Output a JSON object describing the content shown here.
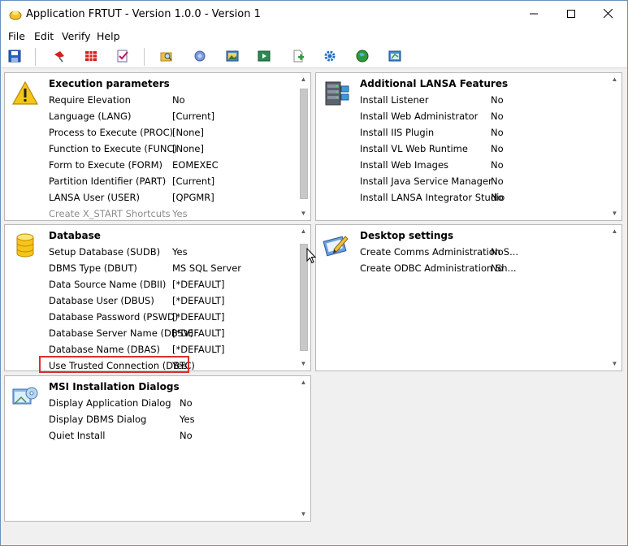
{
  "window": {
    "title": "Application FRTUT - Version 1.0.0 - Version 1"
  },
  "menu": [
    "File",
    "Edit",
    "Verify",
    "Help"
  ],
  "toolbar": [
    "save-icon",
    "pin-icon",
    "grid-icon",
    "verify-icon",
    "folder-search-icon",
    "component-icon",
    "image-icon",
    "media-icon",
    "add-file-icon",
    "gear-icon",
    "globe-icon",
    "window-icon"
  ],
  "colors": {
    "accent": "#1f5fbf",
    "highlight": "#d9302c",
    "panel_border": "#b8b8b8"
  },
  "execution": {
    "title": "Execution parameters",
    "icon": "warning-icon",
    "rows": [
      {
        "label": "Require Elevation",
        "value": "No"
      },
      {
        "label": "Language (LANG)",
        "value": "[Current]"
      },
      {
        "label": "Process to Execute (PROC)",
        "value": "[None]"
      },
      {
        "label": "Function to Execute (FUNC)",
        "value": "[None]"
      },
      {
        "label": "Form to Execute (FORM)",
        "value": "EOMEXEC"
      },
      {
        "label": "Partition Identifier (PART)",
        "value": "[Current]"
      },
      {
        "label": "LANSA User (USER)",
        "value": "[QPGMR]"
      },
      {
        "label": "Create X_START Shortcuts",
        "value": "Yes"
      }
    ]
  },
  "lansa": {
    "title": "Additional LANSA Features",
    "icon": "server-icon",
    "rows": [
      {
        "label": "Install Listener",
        "value": "No"
      },
      {
        "label": "Install Web Administrator",
        "value": "No"
      },
      {
        "label": "Install IIS Plugin",
        "value": "No"
      },
      {
        "label": "Install VL Web Runtime",
        "value": "No"
      },
      {
        "label": "Install Web Images",
        "value": "No"
      },
      {
        "label": "Install Java Service Manager",
        "value": "No"
      },
      {
        "label": "Install LANSA Integrator Studio",
        "value": "No"
      }
    ]
  },
  "database": {
    "title": "Database",
    "icon": "database-icon",
    "rows": [
      {
        "label": "Setup Database (SUDB)",
        "value": "Yes"
      },
      {
        "label": "DBMS Type (DBUT)",
        "value": "MS SQL Server"
      },
      {
        "label": "Data Source Name (DBII)",
        "value": "[*DEFAULT]"
      },
      {
        "label": "Database User (DBUS)",
        "value": "[*DEFAULT]"
      },
      {
        "label": "Database Password (PSWD)",
        "value": "[*DEFAULT]"
      },
      {
        "label": "Database Server Name (DBSV)",
        "value": "[*DEFAULT]"
      },
      {
        "label": "Database Name (DBAS)",
        "value": "[*DEFAULT]"
      },
      {
        "label": "Use Trusted Connection (DBTC)",
        "value": "Yes"
      }
    ]
  },
  "desktop": {
    "title": "Desktop settings",
    "icon": "desktop-settings-icon",
    "rows": [
      {
        "label": "Create Comms Administration S...",
        "value": "No"
      },
      {
        "label": "Create ODBC Administration Sh...",
        "value": "No"
      }
    ]
  },
  "msi": {
    "title": "MSI Installation Dialogs",
    "icon": "install-dialog-icon",
    "rows": [
      {
        "label": "Display Application Dialog",
        "value": "No"
      },
      {
        "label": "Display DBMS Dialog",
        "value": "Yes"
      },
      {
        "label": "Quiet Install",
        "value": "No"
      }
    ]
  }
}
